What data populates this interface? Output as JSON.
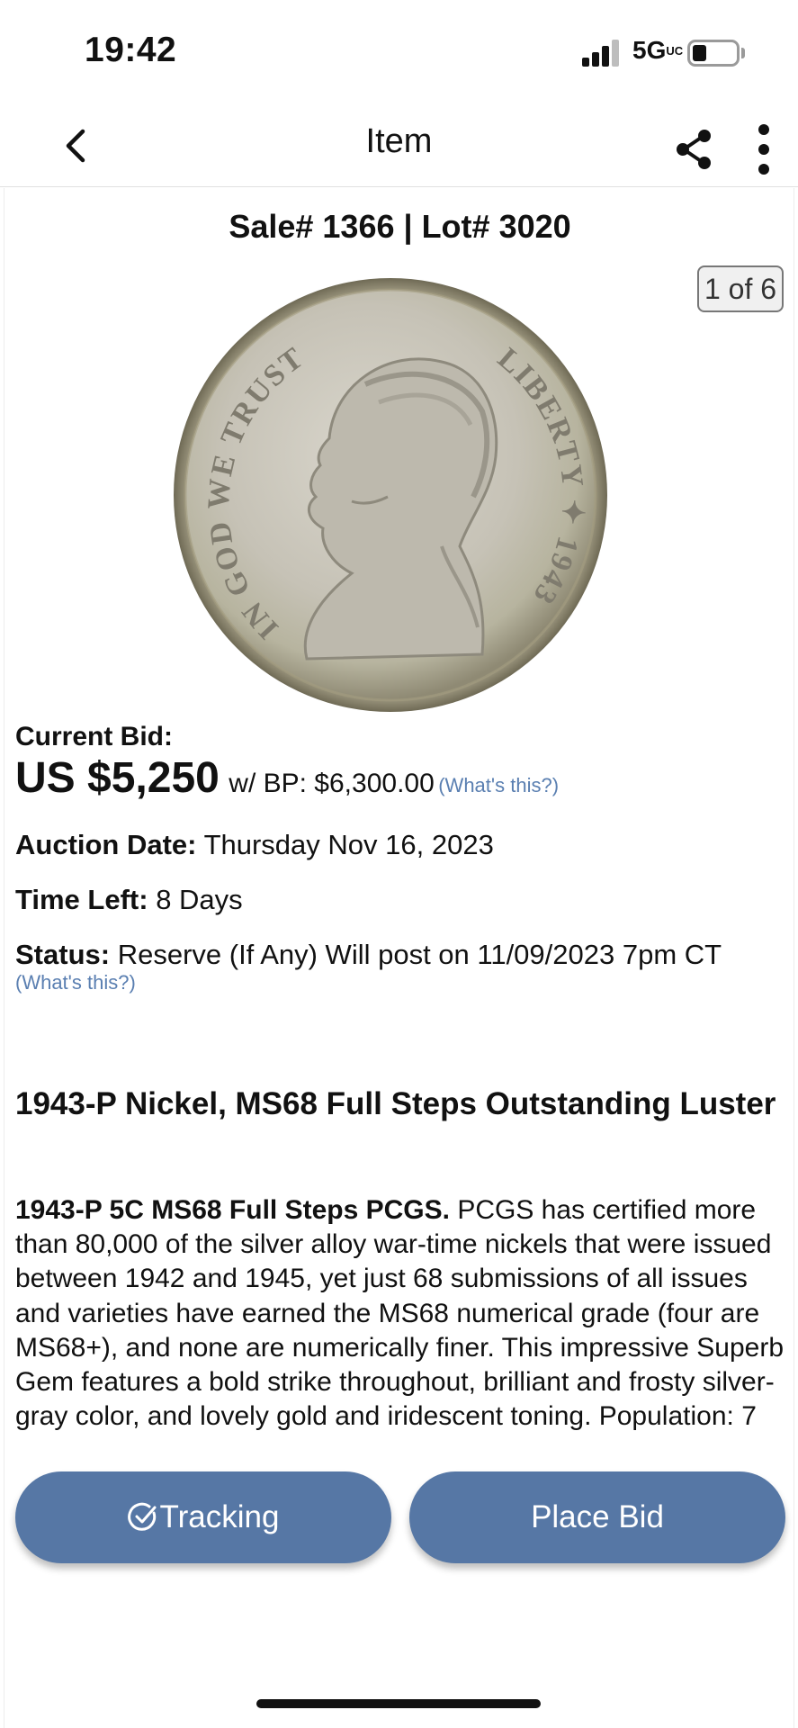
{
  "status_bar": {
    "time": "19:42",
    "network": "5G",
    "network_suffix": "UC",
    "battery_level": 0.25,
    "signal_bars": 3,
    "icons": [
      "signal-bars-icon",
      "battery-icon"
    ]
  },
  "nav": {
    "title": "Item",
    "icons": [
      "chevron-left-icon",
      "share-icon",
      "more-vertical-icon"
    ]
  },
  "item": {
    "sale_lot": "Sale# 1366 | Lot# 3020",
    "image_counter": "1 of 6",
    "coin": {
      "motto": "IN GOD WE TRUST",
      "legend": "LIBERTY",
      "year": "1943"
    },
    "current_bid_label": "Current Bid:",
    "current_bid": "US $5,250",
    "bp_text": "w/ BP: $6,300.00",
    "whats_this_bp": "(What's this?)",
    "auction_date_label": "Auction Date:",
    "auction_date": "Thursday Nov 16, 2023",
    "time_left_label": "Time Left:",
    "time_left": "8 Days",
    "status_label": "Status:",
    "status": "Reserve (If Any) Will post on 11/09/2023 7pm CT",
    "whats_this_status": "(What's this?)",
    "headline": "1943-P Nickel, MS68 Full Steps Outstanding Luster",
    "description_lead": "1943-P 5C MS68 Full Steps PCGS.",
    "description_body": "PCGS has certified more than 80,000 of the silver alloy war-time nickels that were issued between 1942 and 1945, yet just 68 submissions of all issues and varieties have earned the MS68 numerical grade (four are MS68+), and none are numerically finer. This impressive Superb Gem features a bold strike throughout, brilliant and frosty silver-gray color, and lovely gold and iridescent toning. Population: 7"
  },
  "actions": {
    "tracking_label": "Tracking",
    "place_bid_label": "Place Bid",
    "icons": [
      "check-circle-icon"
    ]
  },
  "colors": {
    "accent": "#5677a5",
    "link": "#5a7fb1",
    "text": "#111111"
  }
}
